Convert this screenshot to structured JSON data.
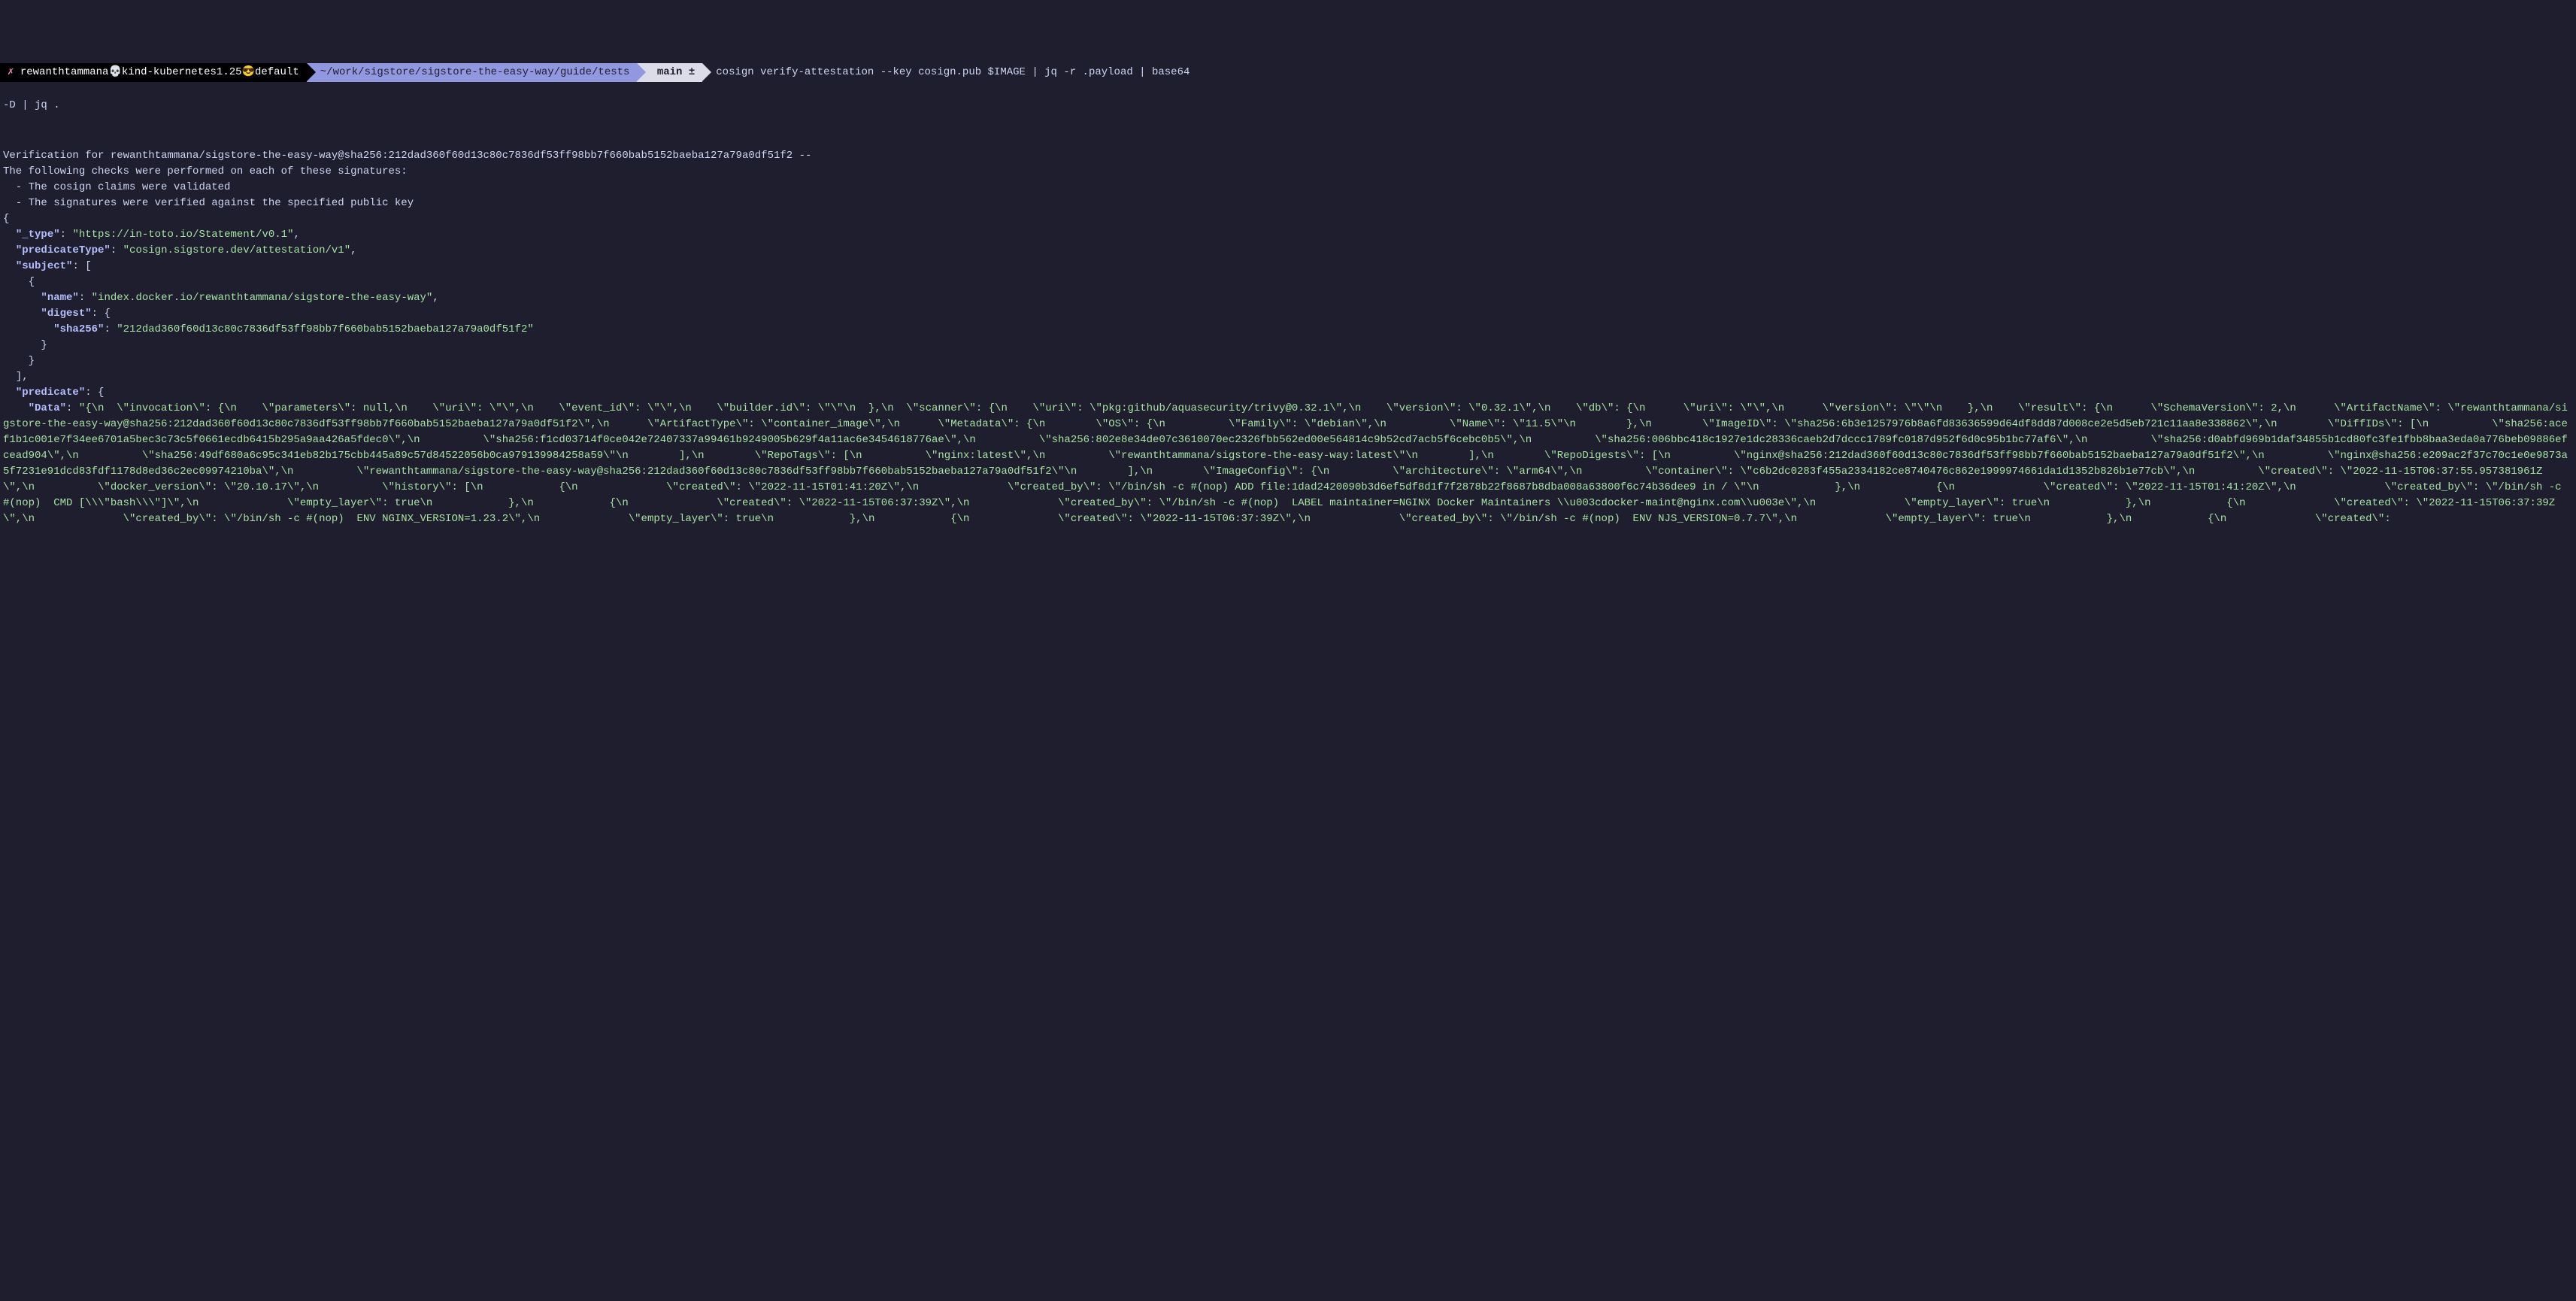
{
  "prompt": {
    "close_x": "✗",
    "user_context": "rewanthtammana💀kind-kubernetes1.25😎default",
    "path": "~/work/sigstore/sigstore-the-easy-way/guide/tests",
    "git_icon": "",
    "git_branch": "main ±",
    "command": "cosign verify-attestation --key cosign.pub $IMAGE | jq -r .payload | base64",
    "continuation": "-D | jq ."
  },
  "verification": {
    "line1": "Verification for rewanthtammana/sigstore-the-easy-way@sha256:212dad360f60d13c80c7836df53ff98bb7f660bab5152baeba127a79a0df51f2 --",
    "line2": "The following checks were performed on each of these signatures:",
    "line3": "  - The cosign claims were validated",
    "line4": "  - The signatures were verified against the specified public key"
  },
  "json": {
    "open": "{",
    "type_key": "\"_type\"",
    "type_val": "\"https://in-toto.io/Statement/v0.1\"",
    "predicateType_key": "\"predicateType\"",
    "predicateType_val": "\"cosign.sigstore.dev/attestation/v1\"",
    "subject_key": "\"subject\"",
    "subject_open": "[",
    "subject_obj_open": "{",
    "name_key": "\"name\"",
    "name_val": "\"index.docker.io/rewanthtammana/sigstore-the-easy-way\"",
    "digest_key": "\"digest\"",
    "digest_open": "{",
    "sha256_key": "\"sha256\"",
    "sha256_val": "\"212dad360f60d13c80c7836df53ff98bb7f660bab5152baeba127a79a0df51f2\"",
    "digest_close": "}",
    "subject_obj_close": "}",
    "subject_close": "],",
    "predicate_key": "\"predicate\"",
    "predicate_open": "{",
    "data_key": "\"Data\"",
    "data_val": "\"{\\n  \\\"invocation\\\": {\\n    \\\"parameters\\\": null,\\n    \\\"uri\\\": \\\"\\\",\\n    \\\"event_id\\\": \\\"\\\",\\n    \\\"builder.id\\\": \\\"\\\"\\n  },\\n  \\\"scanner\\\": {\\n    \\\"uri\\\": \\\"pkg:github/aquasecurity/trivy@0.32.1\\\",\\n    \\\"version\\\": \\\"0.32.1\\\",\\n    \\\"db\\\": {\\n      \\\"uri\\\": \\\"\\\",\\n      \\\"version\\\": \\\"\\\"\\n    },\\n    \\\"result\\\": {\\n      \\\"SchemaVersion\\\": 2,\\n      \\\"ArtifactName\\\": \\\"rewanthtammana/sigstore-the-easy-way@sha256:212dad360f60d13c80c7836df53ff98bb7f660bab5152baeba127a79a0df51f2\\\",\\n      \\\"ArtifactType\\\": \\\"container_image\\\",\\n      \\\"Metadata\\\": {\\n        \\\"OS\\\": {\\n          \\\"Family\\\": \\\"debian\\\",\\n          \\\"Name\\\": \\\"11.5\\\"\\n        },\\n        \\\"ImageID\\\": \\\"sha256:6b3e1257976b8a6fd83636599d64df8dd87d008ce2e5d5eb721c11aa8e338862\\\",\\n        \\\"DiffIDs\\\": [\\n          \\\"sha256:acef1b1c001e7f34ee6701a5bec3c73c5f0661ecdb6415b295a9aa426a5fdec0\\\",\\n          \\\"sha256:f1cd03714f0ce042e72407337a99461b9249005b629f4a11ac6e3454618776ae\\\",\\n          \\\"sha256:802e8e34de07c3610070ec2326fbb562ed00e564814c9b52cd7acb5f6cebc0b5\\\",\\n          \\\"sha256:006bbc418c1927e1dc28336caeb2d7dccc1789fc0187d952f6d0c95b1bc77af6\\\",\\n          \\\"sha256:d0abfd969b1daf34855b1cd80fc3fe1fbb8baa3eda0a776beb09886efcead904\\\",\\n          \\\"sha256:49df680a6c95c341eb82b175cbb445a89c57d84522056b0ca979139984258a59\\\"\\n        ],\\n        \\\"RepoTags\\\": [\\n          \\\"nginx:latest\\\",\\n          \\\"rewanthtammana/sigstore-the-easy-way:latest\\\"\\n        ],\\n        \\\"RepoDigests\\\": [\\n          \\\"nginx@sha256:212dad360f60d13c80c7836df53ff98bb7f660bab5152baeba127a79a0df51f2\\\",\\n          \\\"nginx@sha256:e209ac2f37c70c1e0e9873a5f7231e91dcd83fdf1178d8ed36c2ec09974210ba\\\",\\n          \\\"rewanthtammana/sigstore-the-easy-way@sha256:212dad360f60d13c80c7836df53ff98bb7f660bab5152baeba127a79a0df51f2\\\"\\n        ],\\n        \\\"ImageConfig\\\": {\\n          \\\"architecture\\\": \\\"arm64\\\",\\n          \\\"container\\\": \\\"c6b2dc0283f455a2334182ce8740476c862e1999974661da1d1352b826b1e77cb\\\",\\n          \\\"created\\\": \\\"2022-11-15T06:37:55.957381961Z\\\",\\n          \\\"docker_version\\\": \\\"20.10.17\\\",\\n          \\\"history\\\": [\\n            {\\n              \\\"created\\\": \\\"2022-11-15T01:41:20Z\\\",\\n              \\\"created_by\\\": \\\"/bin/sh -c #(nop) ADD file:1dad2420090b3d6ef5df8d1f7f2878b22f8687b8dba008a63800f6c74b36dee9 in / \\\"\\n            },\\n            {\\n              \\\"created\\\": \\\"2022-11-15T01:41:20Z\\\",\\n              \\\"created_by\\\": \\\"/bin/sh -c #(nop)  CMD [\\\\\\\"bash\\\\\\\"]\\\",\\n              \\\"empty_layer\\\": true\\n            },\\n            {\\n              \\\"created\\\": \\\"2022-11-15T06:37:39Z\\\",\\n              \\\"created_by\\\": \\\"/bin/sh -c #(nop)  LABEL maintainer=NGINX Docker Maintainers \\\\u003cdocker-maint@nginx.com\\\\u003e\\\",\\n              \\\"empty_layer\\\": true\\n            },\\n            {\\n              \\\"created\\\": \\\"2022-11-15T06:37:39Z\\\",\\n              \\\"created_by\\\": \\\"/bin/sh -c #(nop)  ENV NGINX_VERSION=1.23.2\\\",\\n              \\\"empty_layer\\\": true\\n            },\\n            {\\n              \\\"created\\\": \\\"2022-11-15T06:37:39Z\\\",\\n              \\\"created_by\\\": \\\"/bin/sh -c #(nop)  ENV NJS_VERSION=0.7.7\\\",\\n              \\\"empty_layer\\\": true\\n            },\\n            {\\n              \\\"created\\\":"
  }
}
